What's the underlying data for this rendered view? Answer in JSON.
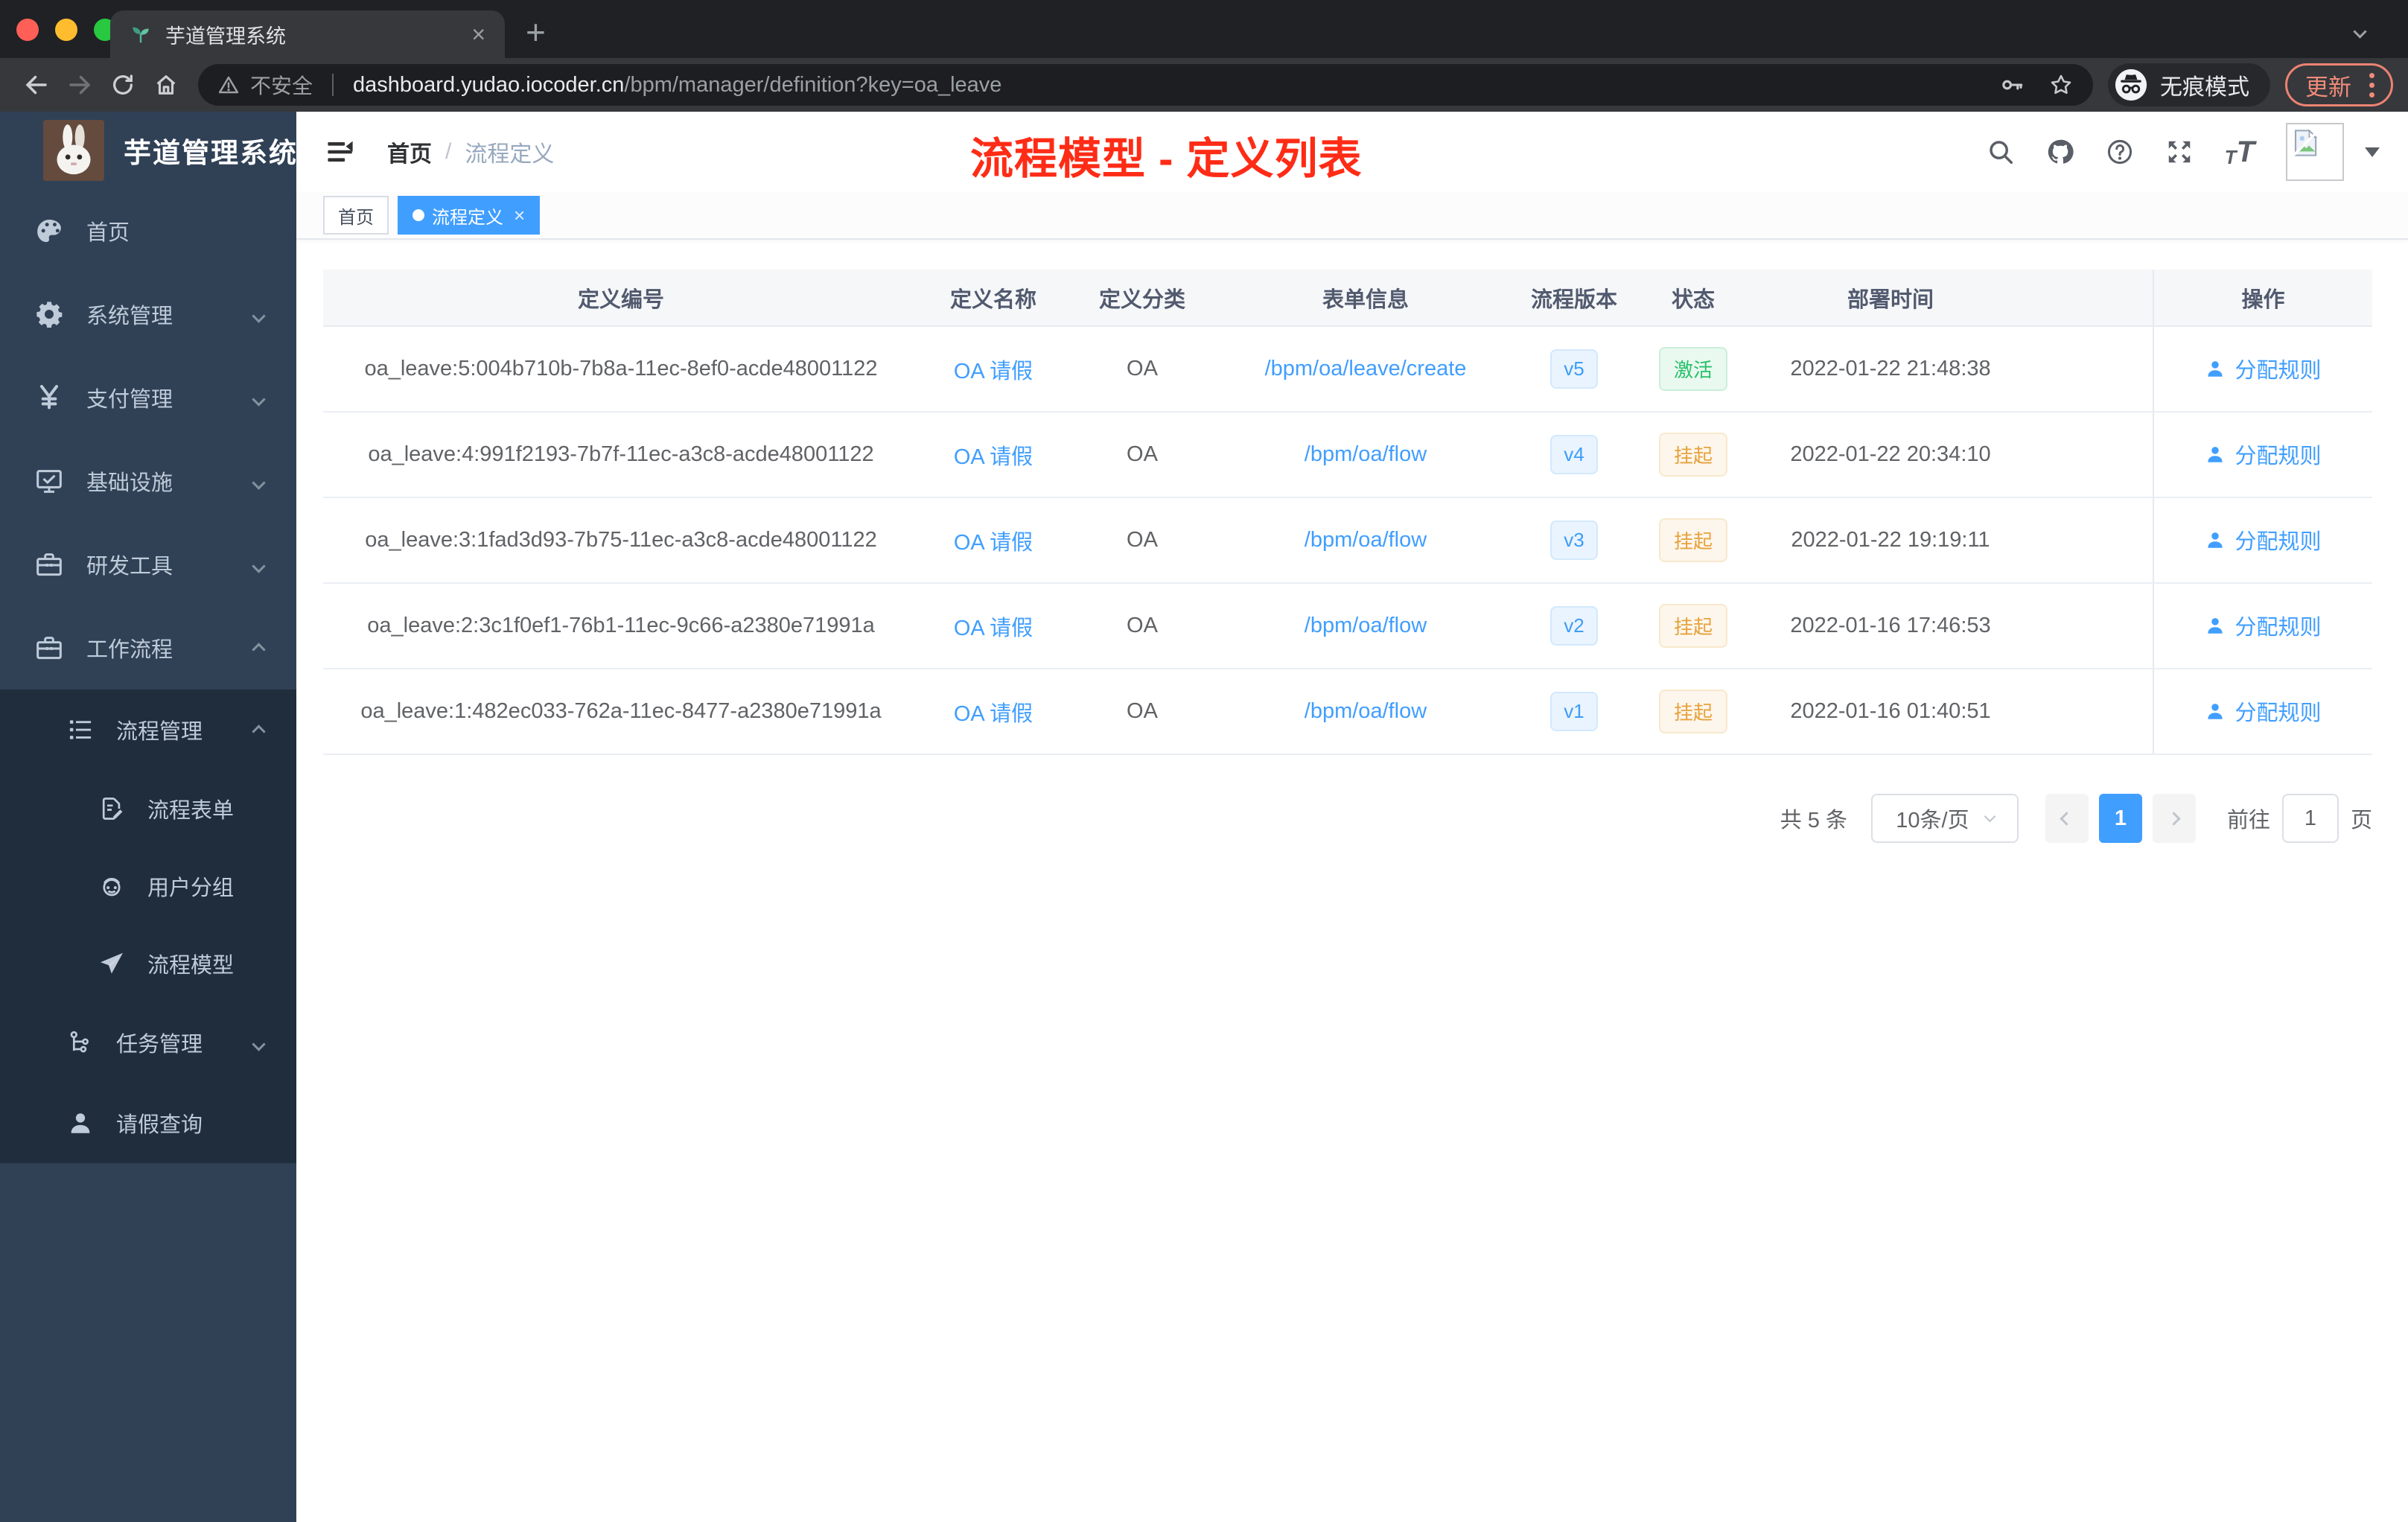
{
  "colors": {
    "accent": "#409eff",
    "sidebar_bg": "#304156",
    "submenu_bg": "#1f2d3d",
    "success_text": "#27c06a",
    "warning_text": "#e6a23c",
    "annotation_red": "#fe2c16",
    "update_salmon": "#f08b78"
  },
  "browser": {
    "tab_title": "芋道管理系统",
    "not_secure_label": "不安全",
    "url_host": "dashboard.yudao.iocoder.cn",
    "url_path": "/bpm/manager/definition?key=oa_leave",
    "incognito_label": "无痕模式",
    "update_label": "更新"
  },
  "sidebar": {
    "logo_title": "芋道管理系统",
    "menu": [
      {
        "label": "首页",
        "icon": "dashboard-icon",
        "level": 1
      },
      {
        "label": "系统管理",
        "icon": "gear-icon",
        "level": 1,
        "chevron": "down"
      },
      {
        "label": "支付管理",
        "icon": "yen-icon",
        "level": 1,
        "chevron": "down"
      },
      {
        "label": "基础设施",
        "icon": "monitor-icon",
        "level": 1,
        "chevron": "down"
      },
      {
        "label": "研发工具",
        "icon": "toolbox-icon",
        "level": 1,
        "chevron": "down"
      },
      {
        "label": "工作流程",
        "icon": "briefcase-icon",
        "level": 1,
        "chevron": "up"
      },
      {
        "label": "流程管理",
        "icon": "list-icon",
        "level": 2,
        "chevron": "up"
      },
      {
        "label": "流程表单",
        "icon": "form-icon",
        "level": 3
      },
      {
        "label": "用户分组",
        "icon": "robot-icon",
        "level": 3
      },
      {
        "label": "流程模型",
        "icon": "paper-plane-icon",
        "level": 3
      },
      {
        "label": "任务管理",
        "icon": "workflow-tree-icon",
        "level": 2,
        "chevron": "down"
      },
      {
        "label": "请假查询",
        "icon": "user-icon",
        "level": 2
      }
    ]
  },
  "header": {
    "breadcrumb_first": "首页",
    "breadcrumb_separator": "/",
    "breadcrumb_last": "流程定义",
    "annotation": "流程模型 - 定义列表"
  },
  "tags": [
    {
      "label": "首页",
      "active": false,
      "closable": false
    },
    {
      "label": "流程定义",
      "active": true,
      "closable": true
    }
  ],
  "table": {
    "columns": [
      "定义编号",
      "定义名称",
      "定义分类",
      "表单信息",
      "流程版本",
      "状态",
      "部署时间",
      "操作"
    ],
    "action_label": "分配规则",
    "rows": [
      {
        "id": "oa_leave:5:004b710b-7b8a-11ec-8ef0-acde48001122",
        "name": "OA 请假",
        "category": "OA",
        "form": "/bpm/oa/leave/create",
        "version": "v5",
        "status": "激活",
        "status_type": "success",
        "deployed": "2022-01-22 21:48:38",
        "action": "分配规则"
      },
      {
        "id": "oa_leave:4:991f2193-7b7f-11ec-a3c8-acde48001122",
        "name": "OA 请假",
        "category": "OA",
        "form": "/bpm/oa/flow",
        "version": "v4",
        "status": "挂起",
        "status_type": "warning",
        "deployed": "2022-01-22 20:34:10",
        "action": "分配规则"
      },
      {
        "id": "oa_leave:3:1fad3d93-7b75-11ec-a3c8-acde48001122",
        "name": "OA 请假",
        "category": "OA",
        "form": "/bpm/oa/flow",
        "version": "v3",
        "status": "挂起",
        "status_type": "warning",
        "deployed": "2022-01-22 19:19:11",
        "action": "分配规则"
      },
      {
        "id": "oa_leave:2:3c1f0ef1-76b1-11ec-9c66-a2380e71991a",
        "name": "OA 请假",
        "category": "OA",
        "form": "/bpm/oa/flow",
        "version": "v2",
        "status": "挂起",
        "status_type": "warning",
        "deployed": "2022-01-16 17:46:53",
        "action": "分配规则"
      },
      {
        "id": "oa_leave:1:482ec033-762a-11ec-8477-a2380e71991a",
        "name": "OA 请假",
        "category": "OA",
        "form": "/bpm/oa/flow",
        "version": "v1",
        "status": "挂起",
        "status_type": "warning",
        "deployed": "2022-01-16 01:40:51",
        "action": "分配规则"
      }
    ]
  },
  "pagination": {
    "total_label": "共 5 条",
    "page_size_label": "10条/页",
    "current_page": "1",
    "goto_label": "前往",
    "page_unit": "页"
  }
}
